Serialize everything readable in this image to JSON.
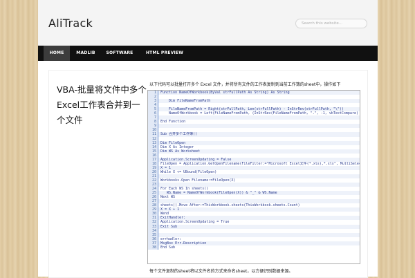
{
  "site": {
    "title": "AliTrack",
    "search_placeholder": "Search this website..."
  },
  "nav": [
    {
      "label": "HOME",
      "active": true
    },
    {
      "label": "MADLIB",
      "active": false
    },
    {
      "label": "SOFTWARE",
      "active": false
    },
    {
      "label": "HTML PREVIEW",
      "active": false
    }
  ],
  "post": {
    "title_line1": "VBA-批量将文件中多个",
    "title_line2": "Excel工作表合并到一个文件",
    "intro": "以下代码可以批量打开多个 Excel 文件，并将所有文件的工作表复制到当前工作簿的sheet中，操作如下",
    "outro": "每个文件复制的sheet将以文件名的方式来命名sheet，以方便识别数据来源。"
  },
  "code": [
    {
      "n": "1",
      "t": "Function NameOfWorkbook(ByVal strFullPath As String) As String"
    },
    {
      "n": "2",
      "t": ""
    },
    {
      "n": "3",
      "t": "    Dim FileNameFromPath"
    },
    {
      "n": "4",
      "t": ""
    },
    {
      "n": "5",
      "t": "    FileNameFromPath = Right(strFullPath, Len(strFullPath) - InStrRev(strFullPath, \"\\\"))"
    },
    {
      "n": "6",
      "t": "    NameOfWorkbook = Left(FileNameFromPath, (InStrRev(FileNameFromPath, \".\", -1, vbTextCompare) - 1))"
    },
    {
      "n": "7",
      "t": ""
    },
    {
      "n": "8",
      "t": "End Function"
    },
    {
      "n": "9",
      "t": ""
    },
    {
      "n": "10",
      "t": ""
    },
    {
      "n": "11",
      "t": "Sub 合并多个工作簿()"
    },
    {
      "n": "12",
      "t": ""
    },
    {
      "n": "13",
      "t": "Dim FileOpen"
    },
    {
      "n": "14",
      "t": "Dim X As Integer"
    },
    {
      "n": "15",
      "t": "Dim WS As Worksheet"
    },
    {
      "n": "16",
      "t": ""
    },
    {
      "n": "17",
      "t": "Application.ScreenUpdating = False"
    },
    {
      "n": "18",
      "t": "FileOpen = Application.GetOpenFilename(FileFilter:=\"Microsoft Excel文件(*.xls),*.xls\", MultiSelect:=True, Title:=\"合并工作簿\")"
    },
    {
      "n": "19",
      "t": "X = 1"
    },
    {
      "n": "20",
      "t": "While X <= UBound(FileOpen)"
    },
    {
      "n": "21",
      "t": ""
    },
    {
      "n": "22",
      "t": "Workbooks.Open Filename:=FileOpen(X)"
    },
    {
      "n": "23",
      "t": ""
    },
    {
      "n": "24",
      "t": "For Each WS In sheets()"
    },
    {
      "n": "25",
      "t": "   WS.Name = NameOfWorkbook(FileOpen(X)) & \"_\" & WS.Name"
    },
    {
      "n": "26",
      "t": "Next WS"
    },
    {
      "n": "27",
      "t": ""
    },
    {
      "n": "28",
      "t": "sheets().Move After:=ThisWorkbook.sheets(ThisWorkbook.sheets.Count)"
    },
    {
      "n": "29",
      "t": "X = X + 1"
    },
    {
      "n": "30",
      "t": "Wend"
    },
    {
      "n": "31",
      "t": "ExitHandler:"
    },
    {
      "n": "32",
      "t": "Application.ScreenUpdating = True"
    },
    {
      "n": "33",
      "t": "Exit Sub"
    },
    {
      "n": "34",
      "t": ""
    },
    {
      "n": "35",
      "t": ""
    },
    {
      "n": "36",
      "t": "errhadler:"
    },
    {
      "n": "37",
      "t": "MsgBox Err.Description"
    },
    {
      "n": "38",
      "t": "End Sub"
    }
  ]
}
